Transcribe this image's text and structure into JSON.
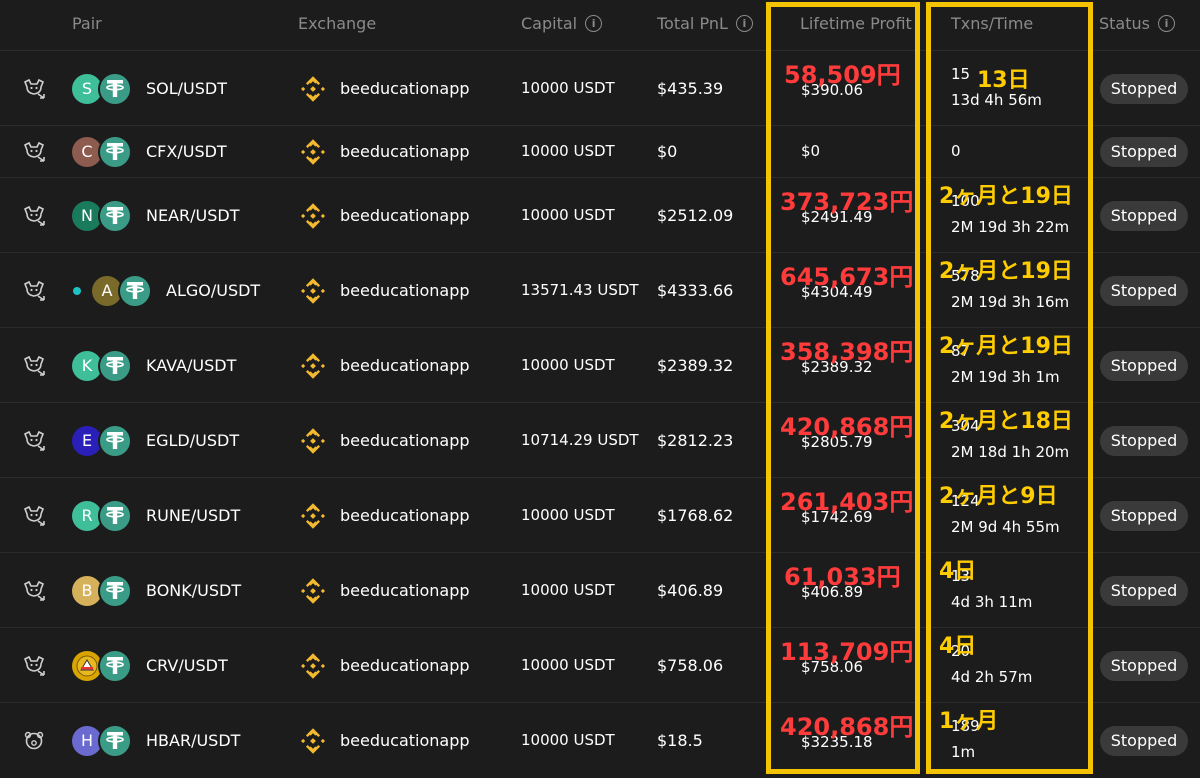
{
  "columns": {
    "pair": "Pair",
    "exchange": "Exchange",
    "capital": "Capital",
    "total_pnl": "Total PnL",
    "lifetime_profit": "Lifetime Profit",
    "txns_time": "Txns/Time",
    "status": "Status"
  },
  "colors": {
    "background": "#1c1c1c",
    "header_text": "#8a8a8a",
    "annotation_red": "#ff3b3b",
    "annotation_yellow": "#ffcc00",
    "highlight_box": "#f5c400",
    "binance_gold": "#f3ba2f",
    "tether_green": "#3a9c86",
    "status_pill": "#3a3a3a"
  },
  "rows": [
    {
      "coin_letter": "S",
      "coin_color": "#3fbf99",
      "pair": "SOL/USDT",
      "exchange": "beeducationapp",
      "capital": "10000 USDT",
      "total_pnl": "$435.39",
      "lifetime_profit": "$390.06",
      "yen_annotation": "58,509円",
      "txns": "15",
      "time": "13d 4h 56m",
      "duration_annotation": "13日",
      "status": "Stopped",
      "bot_icon": "bull-bear-icon"
    },
    {
      "coin_letter": "C",
      "coin_color": "#8e5b4f",
      "pair": "CFX/USDT",
      "exchange": "beeducationapp",
      "capital": "10000 USDT",
      "total_pnl": "$0",
      "lifetime_profit": "$0",
      "yen_annotation": "",
      "txns": "0",
      "time": "",
      "duration_annotation": "",
      "status": "Stopped",
      "bot_icon": "bull-bear-icon"
    },
    {
      "coin_letter": "N",
      "coin_color": "#1a7a5c",
      "pair": "NEAR/USDT",
      "exchange": "beeducationapp",
      "capital": "10000 USDT",
      "total_pnl": "$2512.09",
      "lifetime_profit": "$2491.49",
      "yen_annotation": "373,723円",
      "txns": "100",
      "time": "2M 19d 3h 22m",
      "duration_annotation": "2ヶ月と19日",
      "status": "Stopped",
      "bot_icon": "bull-bear-icon"
    },
    {
      "coin_letter": "A",
      "coin_color": "#7a6a2a",
      "pair": "ALGO/USDT",
      "exchange": "beeducationapp",
      "capital": "13571.43 USDT",
      "total_pnl": "$4333.66",
      "lifetime_profit": "$4304.49",
      "yen_annotation": "645,673円",
      "txns": "578",
      "time": "2M 19d 3h 16m",
      "duration_annotation": "2ヶ月と19日",
      "status": "Stopped",
      "bot_icon": "bull-bear-icon"
    },
    {
      "coin_letter": "K",
      "coin_color": "#3fbf99",
      "pair": "KAVA/USDT",
      "exchange": "beeducationapp",
      "capital": "10000 USDT",
      "total_pnl": "$2389.32",
      "lifetime_profit": "$2389.32",
      "yen_annotation": "358,398円",
      "txns": "87",
      "time": "2M 19d 3h 1m",
      "duration_annotation": "2ヶ月と19日",
      "status": "Stopped",
      "bot_icon": "bull-bear-icon"
    },
    {
      "coin_letter": "E",
      "coin_color": "#2a1fb8",
      "pair": "EGLD/USDT",
      "exchange": "beeducationapp",
      "capital": "10714.29 USDT",
      "total_pnl": "$2812.23",
      "lifetime_profit": "$2805.79",
      "yen_annotation": "420,868円",
      "txns": "304",
      "time": "2M 18d 1h 20m",
      "duration_annotation": "2ヶ月と18日",
      "status": "Stopped",
      "bot_icon": "bull-bear-icon"
    },
    {
      "coin_letter": "R",
      "coin_color": "#3fbf99",
      "pair": "RUNE/USDT",
      "exchange": "beeducationapp",
      "capital": "10000 USDT",
      "total_pnl": "$1768.62",
      "lifetime_profit": "$1742.69",
      "yen_annotation": "261,403円",
      "txns": "124",
      "time": "2M 9d 4h 55m",
      "duration_annotation": "2ヶ月と9日",
      "status": "Stopped",
      "bot_icon": "bull-bear-icon"
    },
    {
      "coin_letter": "B",
      "coin_color": "#d4b15a",
      "pair": "BONK/USDT",
      "exchange": "beeducationapp",
      "capital": "10000 USDT",
      "total_pnl": "$406.89",
      "lifetime_profit": "$406.89",
      "yen_annotation": "61,033円",
      "txns": "13",
      "time": "4d 3h 11m",
      "duration_annotation": "4日",
      "status": "Stopped",
      "bot_icon": "bull-bear-icon"
    },
    {
      "coin_letter": "",
      "coin_color": "#d9a400",
      "pair": "CRV/USDT",
      "exchange": "beeducationapp",
      "capital": "10000 USDT",
      "total_pnl": "$758.06",
      "lifetime_profit": "$758.06",
      "yen_annotation": "113,709円",
      "txns": "20",
      "time": "4d 2h 57m",
      "duration_annotation": "4日",
      "status": "Stopped",
      "bot_icon": "bull-bear-icon"
    },
    {
      "coin_letter": "H",
      "coin_color": "#6a6ad0",
      "pair": "HBAR/USDT",
      "exchange": "beeducationapp",
      "capital": "10000 USDT",
      "total_pnl": "$18.5",
      "lifetime_profit": "$3235.18",
      "yen_annotation": "420,868円",
      "txns": "189",
      "time": "1m",
      "duration_annotation": "1ヶ月",
      "status": "Stopped",
      "bot_icon": "bear-icon"
    }
  ]
}
